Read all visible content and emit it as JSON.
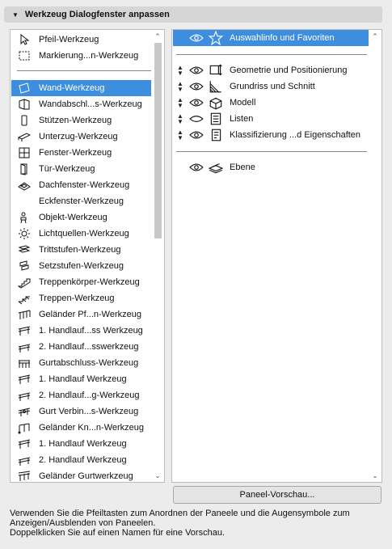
{
  "header": {
    "title": "Werkzeug Dialogfenster anpassen"
  },
  "left_list": {
    "items": [
      {
        "label": "Pfeil-Werkzeug",
        "icon": "arrow-icon"
      },
      {
        "label": "Markierung...n-Werkzeug",
        "icon": "marquee-icon"
      },
      {
        "label": "Wand-Werkzeug",
        "icon": "wall-icon",
        "selected": true
      },
      {
        "label": "Wandabschl...s-Werkzeug",
        "icon": "wall-end-icon"
      },
      {
        "label": "Stützen-Werkzeug",
        "icon": "column-icon"
      },
      {
        "label": "Unterzug-Werkzeug",
        "icon": "beam-icon"
      },
      {
        "label": "Fenster-Werkzeug",
        "icon": "window-icon"
      },
      {
        "label": "Tür-Werkzeug",
        "icon": "door-icon"
      },
      {
        "label": "Dachfenster-Werkzeug",
        "icon": "skylight-icon"
      },
      {
        "label": "Eckfenster-Werkzeug",
        "icon": "none"
      },
      {
        "label": "Objekt-Werkzeug",
        "icon": "object-icon"
      },
      {
        "label": "Lichtquellen-Werkzeug",
        "icon": "lamp-icon"
      },
      {
        "label": "Trittstufen-Werkzeug",
        "icon": "tread-icon"
      },
      {
        "label": "Setzstufen-Werkzeug",
        "icon": "riser-icon"
      },
      {
        "label": "Treppenkörper-Werkzeug",
        "icon": "stair-structure-icon"
      },
      {
        "label": "Treppen-Werkzeug",
        "icon": "stair-icon"
      },
      {
        "label": "Geländer Pf...n-Werkzeug",
        "icon": "railing-post-icon"
      },
      {
        "label": "1. Handlauf...ss Werkzeug",
        "icon": "handrail-icon"
      },
      {
        "label": "2. Handlauf...sswerkzeug",
        "icon": "handrail2-icon"
      },
      {
        "label": "Gurtabschluss-Werkzeug",
        "icon": "toprail-end-icon"
      },
      {
        "label": "1. Handlauf Werkzeug",
        "icon": "handrail-icon"
      },
      {
        "label": "2. Handlauf...g-Werkzeug",
        "icon": "handrail2-icon"
      },
      {
        "label": "Gurt Verbin...s-Werkzeug",
        "icon": "rail-connection-icon"
      },
      {
        "label": "Geländer Kn...n-Werkzeug",
        "icon": "railing-node-icon"
      },
      {
        "label": "1. Handlauf Werkzeug",
        "icon": "handrail-icon"
      },
      {
        "label": "2. Handlauf Werkzeug",
        "icon": "handrail2-icon"
      },
      {
        "label": "Geländer Gurtwerkzeug",
        "icon": "toprail-icon"
      }
    ]
  },
  "right_list": {
    "items": [
      {
        "label": "Auswahlinfo und Favoriten",
        "icon": "star-icon",
        "selected": true,
        "arrows": false
      },
      {
        "label": "Geometrie und Positionierung",
        "icon": "geometry-icon",
        "arrows": true
      },
      {
        "label": "Grundriss und Schnitt",
        "icon": "floorplan-icon",
        "arrows": true
      },
      {
        "label": "Modell",
        "icon": "model-icon",
        "arrows": true
      },
      {
        "label": "Listen",
        "icon": "listing-icon",
        "arrows": true,
        "eye_closed": true
      },
      {
        "label": "Klassifizierung ...d Eigenschaften",
        "icon": "classification-icon",
        "arrows": true
      },
      {
        "label": "Ebene",
        "icon": "layer-icon",
        "arrows": false
      }
    ]
  },
  "buttons": {
    "preview": "Paneel-Vorschau..."
  },
  "hint": {
    "line1": "Verwenden Sie die Pfeiltasten zum Anordnen der Paneele und die Augensymbole zum",
    "line2": "Anzeigen/Ausblenden von Paneelen.",
    "line3": "Doppelklicken Sie auf einen Namen für eine Vorschau."
  },
  "colors": {
    "selection": "#3e8ee0",
    "background": "#ececec",
    "header": "#d6d6d6"
  }
}
